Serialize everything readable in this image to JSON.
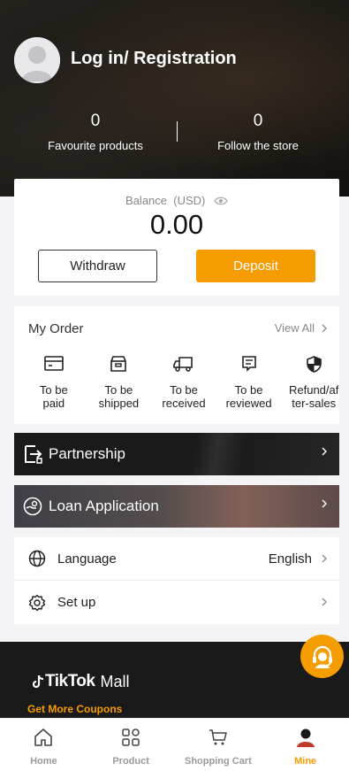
{
  "header": {
    "login_title": "Log in/ Registration",
    "stats": [
      {
        "value": "0",
        "label": "Favourite products"
      },
      {
        "value": "0",
        "label": "Follow the store"
      }
    ]
  },
  "balance": {
    "label": "Balance  (USD)",
    "value": "0.00",
    "withdraw_label": "Withdraw",
    "deposit_label": "Deposit"
  },
  "orders": {
    "title": "My Order",
    "view_all": "View All",
    "items": [
      {
        "icon": "wallet-icon",
        "label": "To be paid"
      },
      {
        "icon": "package-icon",
        "label": "To be shipped"
      },
      {
        "icon": "truck-icon",
        "label": "To be received"
      },
      {
        "icon": "review-icon",
        "label": "To be reviewed"
      },
      {
        "icon": "shield-icon",
        "label": "Refund/after-sales"
      }
    ]
  },
  "banners": {
    "partnership": "Partnership",
    "loan": "Loan Application"
  },
  "settings": {
    "language_label": "Language",
    "language_value": "English",
    "setup_label": "Set up"
  },
  "footer": {
    "brand_tiktok": "TikTok",
    "brand_mall": "Mall",
    "coupons": "Get More Coupons"
  },
  "nav": [
    {
      "label": "Home",
      "active": false
    },
    {
      "label": "Product",
      "active": false
    },
    {
      "label": "Shopping Cart",
      "active": false
    },
    {
      "label": "Mine",
      "active": true
    }
  ],
  "colors": {
    "accent": "#f59c00",
    "dark": "#1a1a1a"
  }
}
